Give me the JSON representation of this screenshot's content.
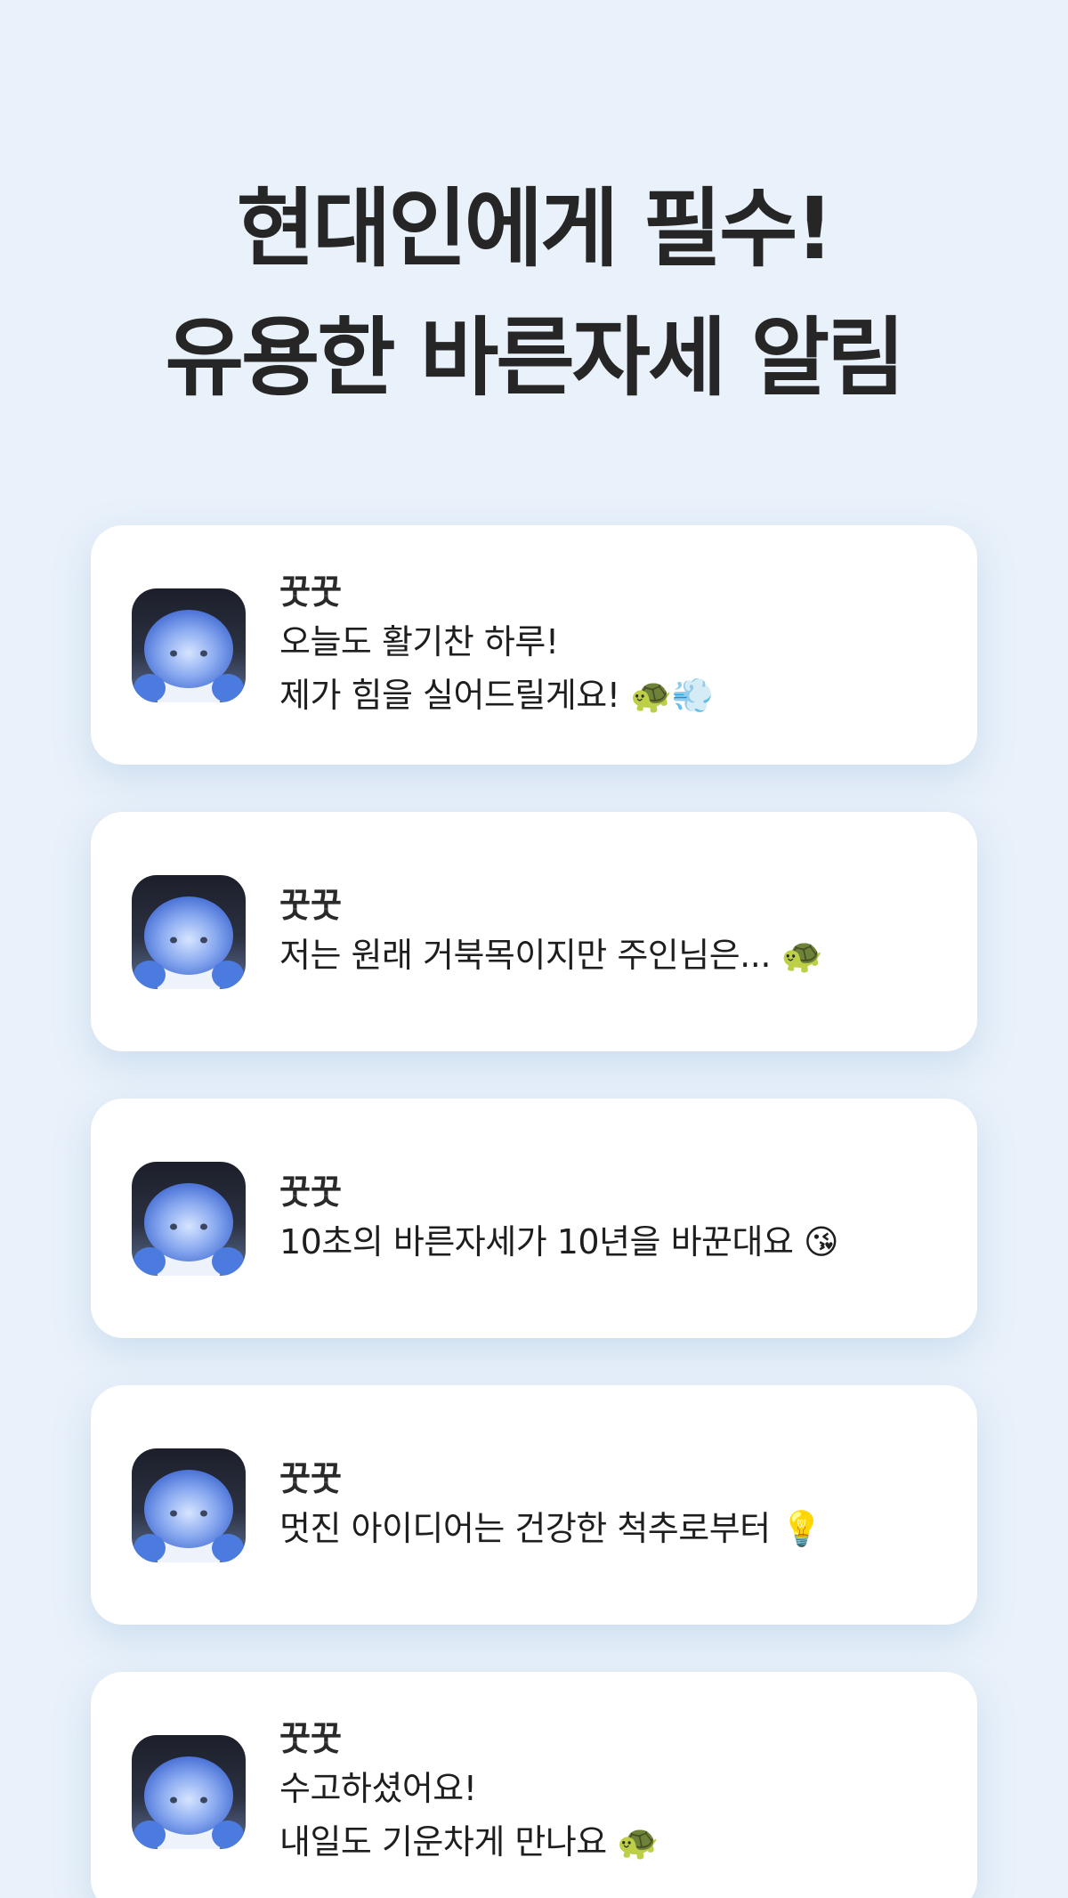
{
  "headline": {
    "line1": "현대인에게 필수!",
    "line2": "유용한 바른자세 알림"
  },
  "notifications": [
    {
      "app_name": "꿋꿋",
      "lines": [
        "오늘도 활기찬 하루!",
        "제가 힘을 실어드릴게요! 🐢💨"
      ]
    },
    {
      "app_name": "꿋꿋",
      "lines": [
        "저는 원래 거북목이지만 주인님은... 🐢"
      ]
    },
    {
      "app_name": "꿋꿋",
      "lines": [
        "10초의 바른자세가 10년을 바꾼대요 😘"
      ]
    },
    {
      "app_name": "꿋꿋",
      "lines": [
        "멋진 아이디어는 건강한 척추로부터 💡"
      ]
    },
    {
      "app_name": "꿋꿋",
      "lines": [
        "수고하셨어요!",
        "내일도 기운차게 만나요 🐢"
      ]
    }
  ],
  "icon_name": "turtle-mascot-app-icon"
}
